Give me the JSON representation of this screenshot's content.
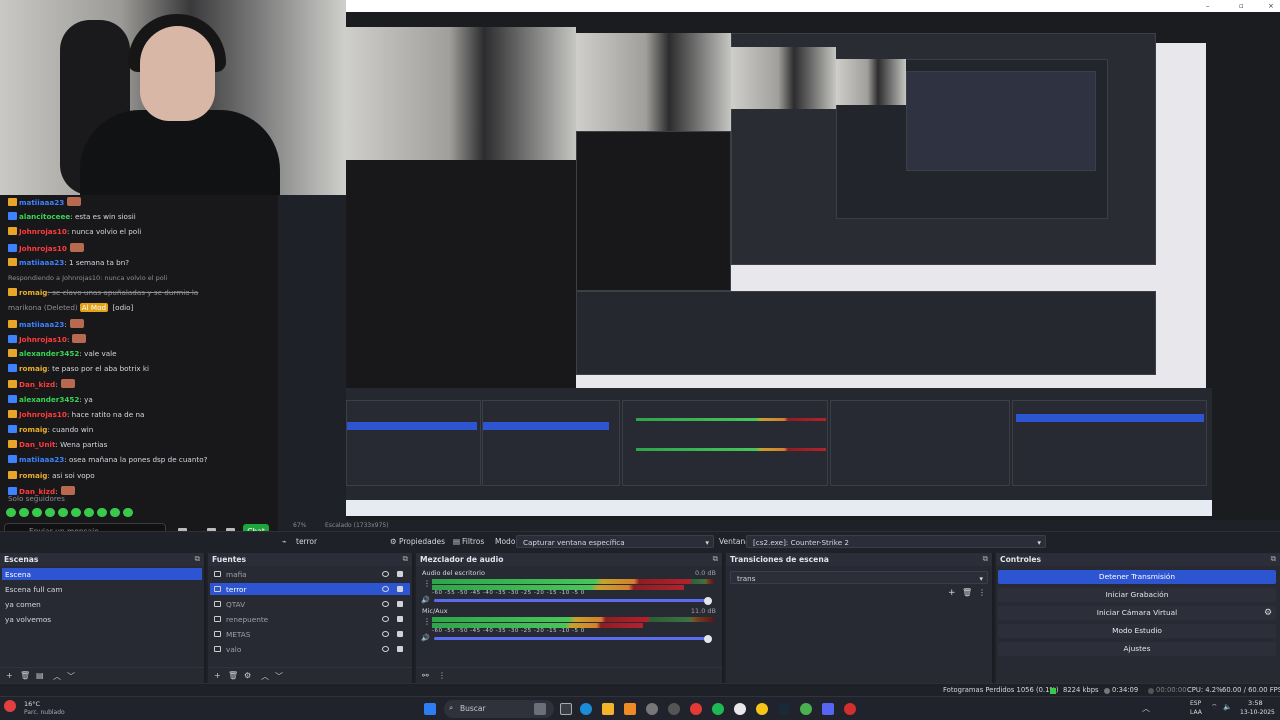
{
  "window": {
    "minimize": "–",
    "maximize": "▫",
    "close": "×"
  },
  "chat": {
    "messages": [
      {
        "user": "matiiaaa23",
        "text": "",
        "color": "#3d82ff",
        "emote": true
      },
      {
        "user": "alancitoceee",
        "text": ": esta es win siosii",
        "color": "#39d353"
      },
      {
        "user": "Johnrojas10",
        "text": ": nunca volvio el poli",
        "color": "#ff3b3b"
      },
      {
        "user": "Johnrojas10",
        "text": "",
        "color": "#ff3b3b",
        "emote": true
      },
      {
        "user": "matiiaaa23",
        "text": ": 1 semana ta bn?",
        "color": "#3d82ff"
      },
      {
        "reply": "Respondiendo a Johnrojas10: nunca volvio el poli"
      },
      {
        "user": "romaig",
        "text": ": se clavo unas apuñaladas y se durmio la",
        "color": "#e9b12b",
        "strike": true
      },
      {
        "cont": "marikona (Deleted)",
        "badge": "Al Mod",
        "tail": " [odio]"
      },
      {
        "user": "matiiaaa23",
        "text": ":",
        "color": "#3d82ff",
        "emote": true
      },
      {
        "user": "Johnrojas10",
        "text": ":",
        "color": "#ff3b3b",
        "emote": true
      },
      {
        "user": "alexander3452",
        "text": ": vale vale",
        "color": "#39d353"
      },
      {
        "user": "romaig",
        "text": ": te paso por el aba botrix ki",
        "color": "#e9b12b"
      },
      {
        "user": "Dan_kizd",
        "text": ":",
        "color": "#ff3b3b",
        "emote": true
      },
      {
        "user": "alexander3452",
        "text": ": ya",
        "color": "#39d353"
      },
      {
        "user": "Johnrojas10",
        "text": ": hace ratito na de na",
        "color": "#ff3b3b"
      },
      {
        "user": "romaig",
        "text": ": cuando win",
        "color": "#e9b12b"
      },
      {
        "user": "Dan_Unit",
        "text": ": Wena partias",
        "color": "#ff3b3b"
      },
      {
        "user": "matiiaaa23",
        "text": ": osea mañana la pones dsp de cuanto?",
        "color": "#3d82ff"
      },
      {
        "user": "romaig",
        "text": ": asi soi vopo",
        "color": "#e9b12b"
      },
      {
        "user": "Dan_kizd",
        "text": ":",
        "color": "#ff3b3b",
        "emote": true
      }
    ],
    "followers_only": "Solo seguidores",
    "input_placeholder": "Enviar un mensaje",
    "chat_button": "Chat"
  },
  "toolbar": {
    "source_name": "terror",
    "properties": "Propiedades",
    "filters": "Filtros",
    "mode_label": "Modo",
    "mode_value": "Capturar ventana específica",
    "window_label": "Ventana",
    "window_value": "[cs2.exe]: Counter-Strike 2",
    "zoom": "67%",
    "canvas": "Escalado (1733x975)"
  },
  "scenes": {
    "title": "Escenas",
    "items": [
      "Escena",
      "Escena full cam",
      "ya comen",
      "ya volvemos"
    ],
    "selected": 0
  },
  "sources": {
    "title": "Fuentes",
    "items": [
      "mafia",
      "terror",
      "QTAV",
      "renepuente",
      "METAS",
      "valo"
    ],
    "selected": 1
  },
  "mixer": {
    "title": "Mezclador de audio",
    "channels": [
      {
        "name": "Audio del escritorio",
        "db": "0.0 dB",
        "level": 0.92,
        "volume": 1.0
      },
      {
        "name": "Mic/Aux",
        "db": "11.0 dB",
        "level": 0.77,
        "volume": 1.0
      }
    ],
    "ticks": "-60  -55  -50  -45  -40  -35  -30  -25  -20  -15  -10   -5   0"
  },
  "transitions": {
    "title": "Transiciones de escena",
    "value": "trans"
  },
  "controls": {
    "title": "Controles",
    "buttons": [
      "Detener Transmisión",
      "Iniciar Grabación",
      "Iniciar Cámara Virtual",
      "Modo Estudio",
      "Ajustes"
    ]
  },
  "status": {
    "dropped": "Fotogramas Perdidos 1056 (0.1%)",
    "bitrate": "8224 kbps",
    "stream_time": "0:34:09",
    "rec_time": "00:00:00",
    "cpu": "CPU: 4.2%",
    "fps": "60.00 / 60.00 FPS"
  },
  "taskbar": {
    "weather_temp": "16°C",
    "weather_desc": "Parc. nublado",
    "search": "Buscar",
    "lang": "ESP",
    "layout": "LAA",
    "time": "3:58",
    "date": "13-10-2025"
  }
}
